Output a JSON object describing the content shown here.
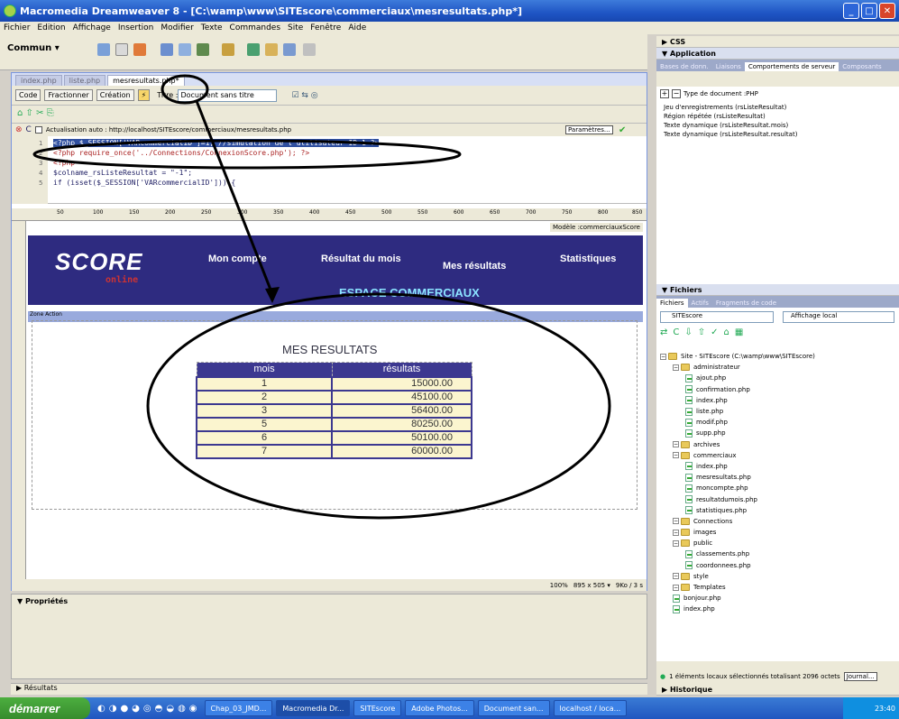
{
  "window": {
    "title": "Macromedia Dreamweaver 8 - [C:\\wamp\\www\\SITEscore\\commerciaux\\mesresultats.php*]"
  },
  "menu": [
    "Fichier",
    "Edition",
    "Affichage",
    "Insertion",
    "Modifier",
    "Texte",
    "Commandes",
    "Site",
    "Fenêtre",
    "Aide"
  ],
  "insertbar": {
    "category": "Commun ▾"
  },
  "doc": {
    "tabs": [
      "index.php",
      "liste.php",
      "mesresultats.php*"
    ],
    "code_btn": "Code",
    "split_btn": "Fractionner",
    "design_btn": "Création",
    "title_label": "Titre :",
    "title_value": "Document sans titre",
    "update_text": "Actualisation auto : http://localhost/SITEscore/commerciaux/mesresultats.php",
    "params_btn": "Paramètres...",
    "code_lines": [
      {
        "n": "1",
        "t": "<?php $_SESSION['VARcommercialID']=1; //simulation de l'utilisateur ID=1 ?>"
      },
      {
        "n": "2",
        "t": "<?php require_once('../Connections/ConnexionScore.php'); ?>"
      },
      {
        "n": "3",
        "t": "<?php"
      },
      {
        "n": "4",
        "t": "$colname_rsListeResultat = \"-1\";"
      },
      {
        "n": "5",
        "t": "if (isset($_SESSION['VARcommercialID'])) {"
      }
    ],
    "ruler": [
      "50",
      "100",
      "150",
      "200",
      "250",
      "300",
      "350",
      "400",
      "450",
      "500",
      "550",
      "600",
      "650",
      "700",
      "750",
      "800",
      "850"
    ]
  },
  "page": {
    "logo": "SCORE",
    "logo_sub": "online",
    "nav": [
      "Mon compte",
      "Résultat du mois",
      "Mes résultats",
      "Statistiques"
    ],
    "espace": "ESPACE COMMERCIAUX",
    "modele": "Modèle :commerciauxScore",
    "region": "Zone Action",
    "heading": "MES RESULTATS",
    "table": {
      "headers": [
        "mois",
        "résultats"
      ],
      "rows": [
        [
          "1",
          "15000.00"
        ],
        [
          "2",
          "45100.00"
        ],
        [
          "3",
          "56400.00"
        ],
        [
          "5",
          "80250.00"
        ],
        [
          "6",
          "50100.00"
        ],
        [
          "7",
          "60000.00"
        ]
      ]
    }
  },
  "status": {
    "zoom": "100%",
    "size": "895 x 505 ▾",
    "weight": "9Ko / 3 s"
  },
  "props": {
    "title": "▼ Propriétés"
  },
  "results": {
    "title": "▶ Résultats"
  },
  "right": {
    "css": "▶ CSS",
    "application": "▼ Application",
    "app_tabs": [
      "Bases de donn.",
      "Liaisons",
      "Comportements de serveur",
      "Composants"
    ],
    "doctype": "Type de document :PHP",
    "behaviors": [
      "Jeu d'enregistrements (rsListeResultat)",
      "Région répétée (rsListeResultat)",
      "Texte dynamique (rsListeResultat.mois)",
      "Texte dynamique (rsListeResultat.resultat)"
    ],
    "files_title": "▼ Fichiers",
    "files_tabs": [
      "Fichiers",
      "Actifs",
      "Fragments de code"
    ],
    "site": "SITEscore",
    "view": "Affichage local",
    "tree": [
      {
        "d": 0,
        "k": "folder",
        "t": "Site - SITEscore (C:\\wamp\\www\\SITEscore)"
      },
      {
        "d": 1,
        "k": "folder",
        "t": "administrateur"
      },
      {
        "d": 2,
        "k": "file",
        "t": "ajout.php"
      },
      {
        "d": 2,
        "k": "file",
        "t": "confirmation.php"
      },
      {
        "d": 2,
        "k": "file",
        "t": "index.php"
      },
      {
        "d": 2,
        "k": "file",
        "t": "liste.php"
      },
      {
        "d": 2,
        "k": "file",
        "t": "modif.php"
      },
      {
        "d": 2,
        "k": "file",
        "t": "supp.php"
      },
      {
        "d": 1,
        "k": "folder",
        "t": "archives"
      },
      {
        "d": 1,
        "k": "folder",
        "t": "commerciaux"
      },
      {
        "d": 2,
        "k": "file",
        "t": "index.php"
      },
      {
        "d": 2,
        "k": "file",
        "t": "mesresultats.php"
      },
      {
        "d": 2,
        "k": "file",
        "t": "moncompte.php"
      },
      {
        "d": 2,
        "k": "file",
        "t": "resultatdumois.php"
      },
      {
        "d": 2,
        "k": "file",
        "t": "statistiques.php"
      },
      {
        "d": 1,
        "k": "folder",
        "t": "Connections"
      },
      {
        "d": 1,
        "k": "folder",
        "t": "images"
      },
      {
        "d": 1,
        "k": "folder",
        "t": "public"
      },
      {
        "d": 2,
        "k": "file",
        "t": "classements.php"
      },
      {
        "d": 2,
        "k": "file",
        "t": "coordonnees.php"
      },
      {
        "d": 1,
        "k": "folder",
        "t": "style"
      },
      {
        "d": 1,
        "k": "folder",
        "t": "Templates"
      },
      {
        "d": 1,
        "k": "file",
        "t": "bonjour.php"
      },
      {
        "d": 1,
        "k": "file",
        "t": "index.php"
      }
    ],
    "files_status": "1 éléments locaux sélectionnés totalisant 2096 octets",
    "journal": "Journal...",
    "historique": "▶ Historique"
  },
  "taskbar": {
    "start": "démarrer",
    "tasks": [
      "Chap_03_JMD...",
      "Macromedia Dr...",
      "SITEscore",
      "Adobe Photos...",
      "Document san...",
      "localhost / loca..."
    ],
    "clock": "23:40"
  }
}
